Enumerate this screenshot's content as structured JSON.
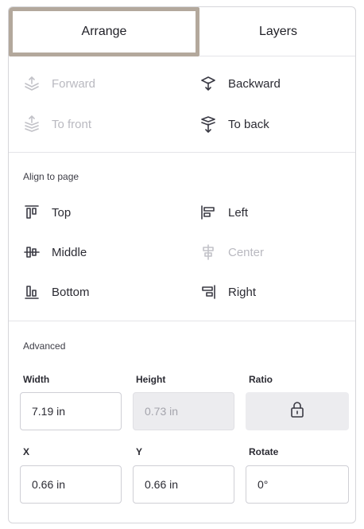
{
  "tabs": {
    "arrange": "Arrange",
    "layers": "Layers"
  },
  "order": {
    "forward": "Forward",
    "backward": "Backward",
    "to_front": "To front",
    "to_back": "To back"
  },
  "align": {
    "title": "Align to page",
    "top": "Top",
    "left": "Left",
    "middle": "Middle",
    "center": "Center",
    "bottom": "Bottom",
    "right": "Right"
  },
  "advanced": {
    "title": "Advanced",
    "width_label": "Width",
    "height_label": "Height",
    "ratio_label": "Ratio",
    "width_value": "7.19 in",
    "height_value": "0.73 in",
    "x_label": "X",
    "y_label": "Y",
    "rotate_label": "Rotate",
    "x_value": "0.66 in",
    "y_value": "0.66 in",
    "rotate_value": "0°"
  },
  "colors": {
    "active_tab_border": "#b3a89c",
    "disabled_text": "#b9b9c0",
    "disabled_field_bg": "#ececef"
  }
}
